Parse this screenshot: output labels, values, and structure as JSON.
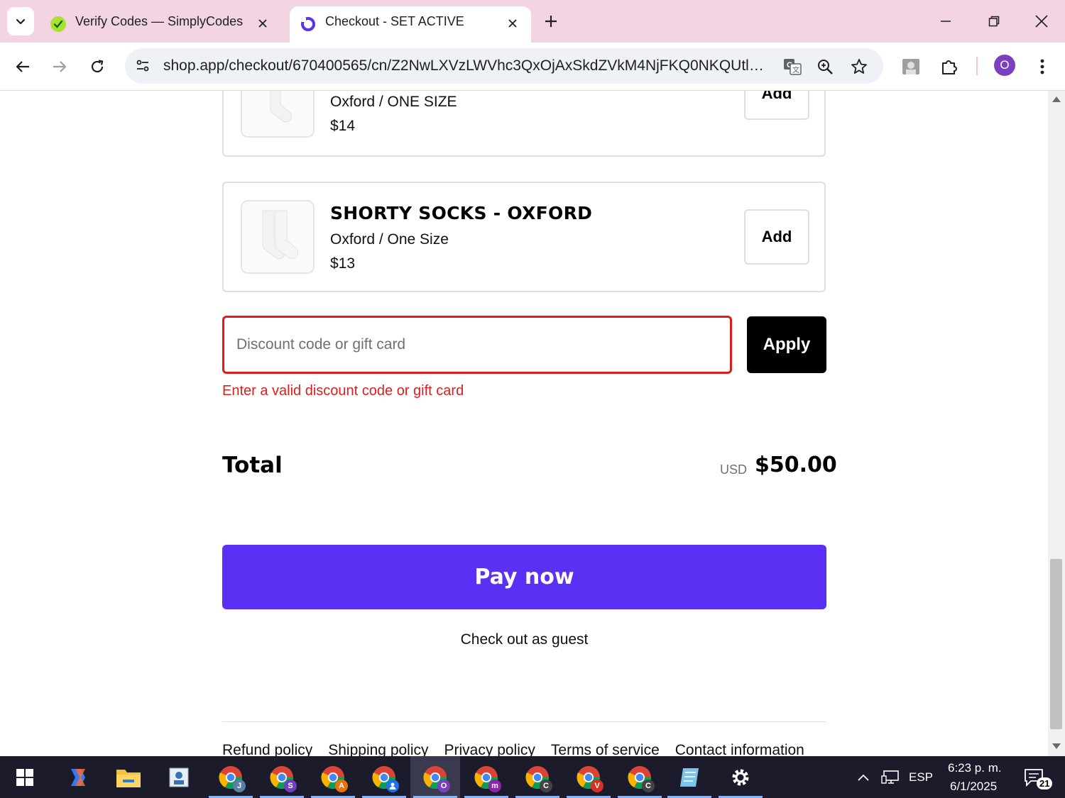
{
  "browser": {
    "tabs": [
      {
        "title": "Verify Codes — SimplyCodes",
        "active": false
      },
      {
        "title": "Checkout - SET ACTIVE",
        "active": true
      }
    ],
    "url": "shop.app/checkout/670400565/cn/Z2NwLXVzLWVhc3QxOjAxSkdZVkM4NjFKQ0NKQUtlMjkx...",
    "profile_initial": "O"
  },
  "products": [
    {
      "name": "",
      "variant": "Oxford / ONE SIZE",
      "price": "$14",
      "add_label": "Add"
    },
    {
      "name": "SHORTY SOCKS - OXFORD",
      "variant": "Oxford / One Size",
      "price": "$13",
      "add_label": "Add"
    }
  ],
  "discount": {
    "placeholder": "Discount code or gift card",
    "value": "",
    "apply_label": "Apply",
    "error": "Enter a valid discount code or gift card"
  },
  "total": {
    "label": "Total",
    "currency": "USD",
    "amount": "$50.00"
  },
  "actions": {
    "pay_label": "Pay now",
    "guest_label": "Check out as guest"
  },
  "footer": {
    "links": [
      "Refund policy",
      "Shipping policy",
      "Privacy policy",
      "Terms of service",
      "Contact information"
    ]
  },
  "taskbar": {
    "chrome_profiles": [
      {
        "letter": "J",
        "color": "#5b7fa6"
      },
      {
        "letter": "S",
        "color": "#6f3fbf"
      },
      {
        "letter": "A",
        "color": "#e8710a"
      },
      {
        "letter": "",
        "color": "#1a73e8"
      },
      {
        "letter": "O",
        "color": "#7b3fc2"
      },
      {
        "letter": "m",
        "color": "#8e24aa"
      },
      {
        "letter": "C",
        "color": "#444444"
      },
      {
        "letter": "V",
        "color": "#d93025"
      },
      {
        "letter": "C",
        "color": "#444444"
      }
    ],
    "language": "ESP",
    "time": "6:23 p. m.",
    "date": "6/1/2025",
    "notifications": "21"
  },
  "colors": {
    "accent": "#5a31f4",
    "error": "#dd1d1d",
    "tabstrip": "#f3d4e3"
  }
}
